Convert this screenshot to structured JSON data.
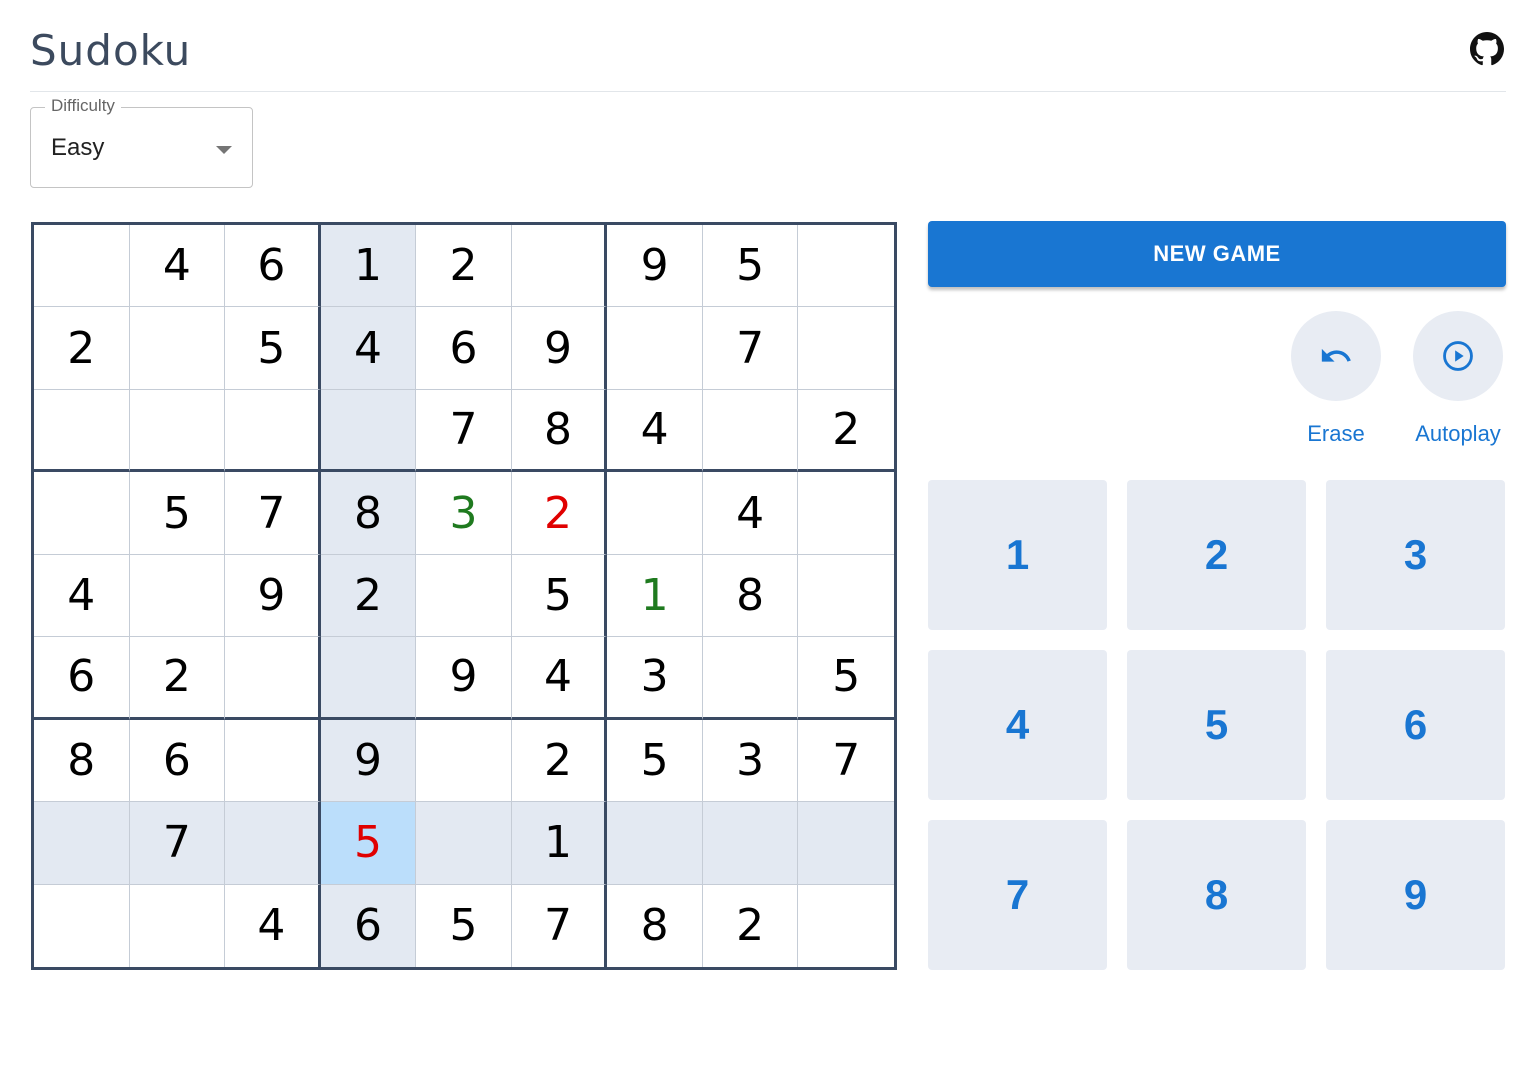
{
  "header": {
    "title": "Sudoku",
    "github_icon": "github-icon"
  },
  "difficulty": {
    "label": "Difficulty",
    "value": "Easy"
  },
  "board": {
    "selected": [
      7,
      3
    ],
    "rows": [
      [
        {
          "v": ""
        },
        {
          "v": "4"
        },
        {
          "v": "6"
        },
        {
          "v": "1"
        },
        {
          "v": "2"
        },
        {
          "v": ""
        },
        {
          "v": "9"
        },
        {
          "v": "5"
        },
        {
          "v": ""
        }
      ],
      [
        {
          "v": "2"
        },
        {
          "v": ""
        },
        {
          "v": "5"
        },
        {
          "v": "4"
        },
        {
          "v": "6"
        },
        {
          "v": "9"
        },
        {
          "v": ""
        },
        {
          "v": "7"
        },
        {
          "v": ""
        }
      ],
      [
        {
          "v": ""
        },
        {
          "v": ""
        },
        {
          "v": ""
        },
        {
          "v": ""
        },
        {
          "v": "7"
        },
        {
          "v": "8"
        },
        {
          "v": "4"
        },
        {
          "v": ""
        },
        {
          "v": "2"
        }
      ],
      [
        {
          "v": ""
        },
        {
          "v": "5"
        },
        {
          "v": "7"
        },
        {
          "v": "8"
        },
        {
          "v": "3",
          "s": "correct"
        },
        {
          "v": "2",
          "s": "wrong"
        },
        {
          "v": ""
        },
        {
          "v": "4"
        },
        {
          "v": ""
        }
      ],
      [
        {
          "v": "4"
        },
        {
          "v": ""
        },
        {
          "v": "9"
        },
        {
          "v": "2"
        },
        {
          "v": ""
        },
        {
          "v": "5"
        },
        {
          "v": "1",
          "s": "correct"
        },
        {
          "v": "8"
        },
        {
          "v": ""
        }
      ],
      [
        {
          "v": "6"
        },
        {
          "v": "2"
        },
        {
          "v": ""
        },
        {
          "v": ""
        },
        {
          "v": "9"
        },
        {
          "v": "4"
        },
        {
          "v": "3"
        },
        {
          "v": ""
        },
        {
          "v": "5"
        }
      ],
      [
        {
          "v": "8"
        },
        {
          "v": "6"
        },
        {
          "v": ""
        },
        {
          "v": "9"
        },
        {
          "v": ""
        },
        {
          "v": "2"
        },
        {
          "v": "5"
        },
        {
          "v": "3"
        },
        {
          "v": "7"
        }
      ],
      [
        {
          "v": ""
        },
        {
          "v": "7"
        },
        {
          "v": ""
        },
        {
          "v": "5",
          "s": "wrong"
        },
        {
          "v": ""
        },
        {
          "v": "1"
        },
        {
          "v": ""
        },
        {
          "v": ""
        },
        {
          "v": ""
        }
      ],
      [
        {
          "v": ""
        },
        {
          "v": ""
        },
        {
          "v": "4"
        },
        {
          "v": "6"
        },
        {
          "v": "5"
        },
        {
          "v": "7"
        },
        {
          "v": "8"
        },
        {
          "v": "2"
        },
        {
          "v": ""
        }
      ]
    ]
  },
  "controls": {
    "new_game_label": "NEW GAME",
    "erase_label": "Erase",
    "erase_icon": "undo-icon",
    "autoplay_label": "Autoplay",
    "autoplay_icon": "play-circle-icon"
  },
  "numpad": [
    "1",
    "2",
    "3",
    "4",
    "5",
    "6",
    "7",
    "8",
    "9"
  ],
  "colors": {
    "accent": "#1976d2",
    "correct": "#1f7a1f",
    "wrong": "#e00000",
    "highlight": "#e3e9f2",
    "selected": "#bbdefb"
  }
}
